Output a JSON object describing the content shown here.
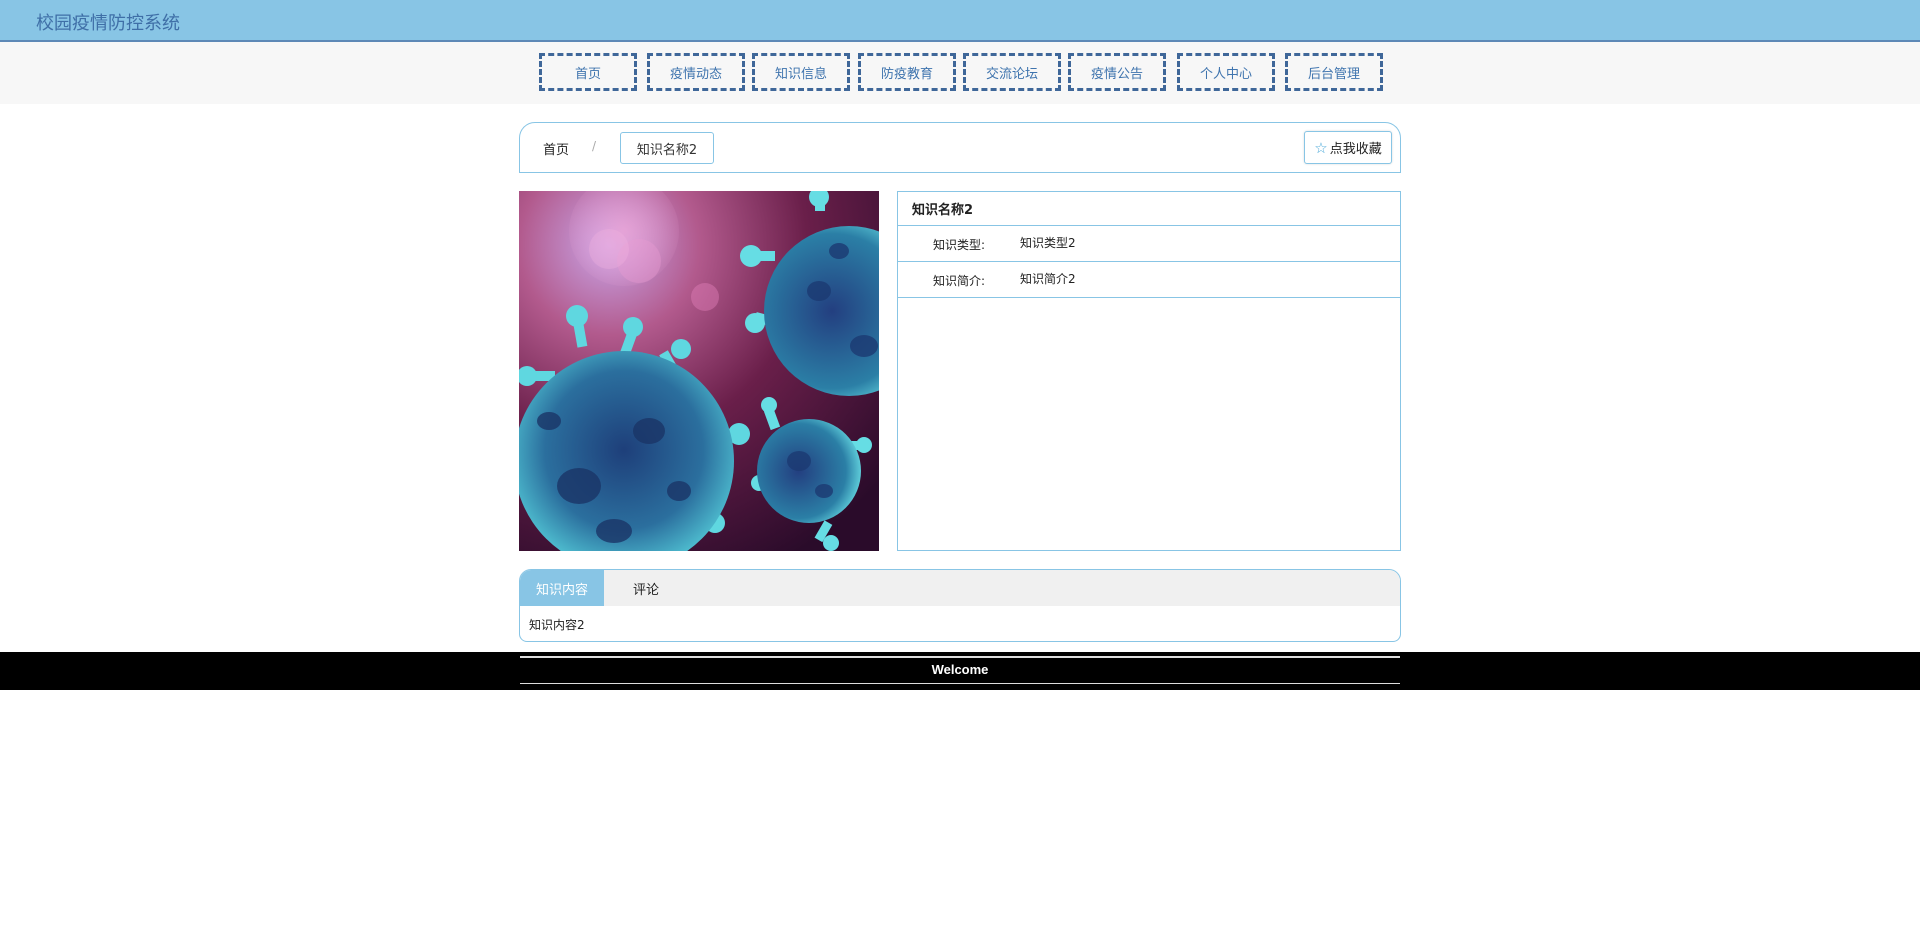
{
  "header": {
    "title": "校园疫情防控系统"
  },
  "nav": {
    "items": [
      {
        "label": "首页"
      },
      {
        "label": "疫情动态"
      },
      {
        "label": "知识信息"
      },
      {
        "label": "防疫教育"
      },
      {
        "label": "交流论坛"
      },
      {
        "label": "疫情公告"
      },
      {
        "label": "个人中心"
      },
      {
        "label": "后台管理"
      }
    ]
  },
  "breadcrumb": {
    "home": "首页",
    "separator": "/",
    "current": "知识名称2"
  },
  "favorite_button": {
    "label": "点我收藏",
    "icon": "star-icon"
  },
  "image": {
    "subject": "coronavirus-illustration"
  },
  "detail": {
    "title": "知识名称2",
    "rows": [
      {
        "label": "知识类型:",
        "value": "知识类型2"
      },
      {
        "label": "知识简介:",
        "value": "知识简介2"
      }
    ]
  },
  "tabs": {
    "items": [
      {
        "label": "知识内容"
      },
      {
        "label": "评论"
      }
    ],
    "content": "知识内容2"
  },
  "footer": {
    "text": "Welcome"
  },
  "colors": {
    "accent": "#88c5e5",
    "nav_border": "#3f6799",
    "footer_bg": "#000000"
  }
}
